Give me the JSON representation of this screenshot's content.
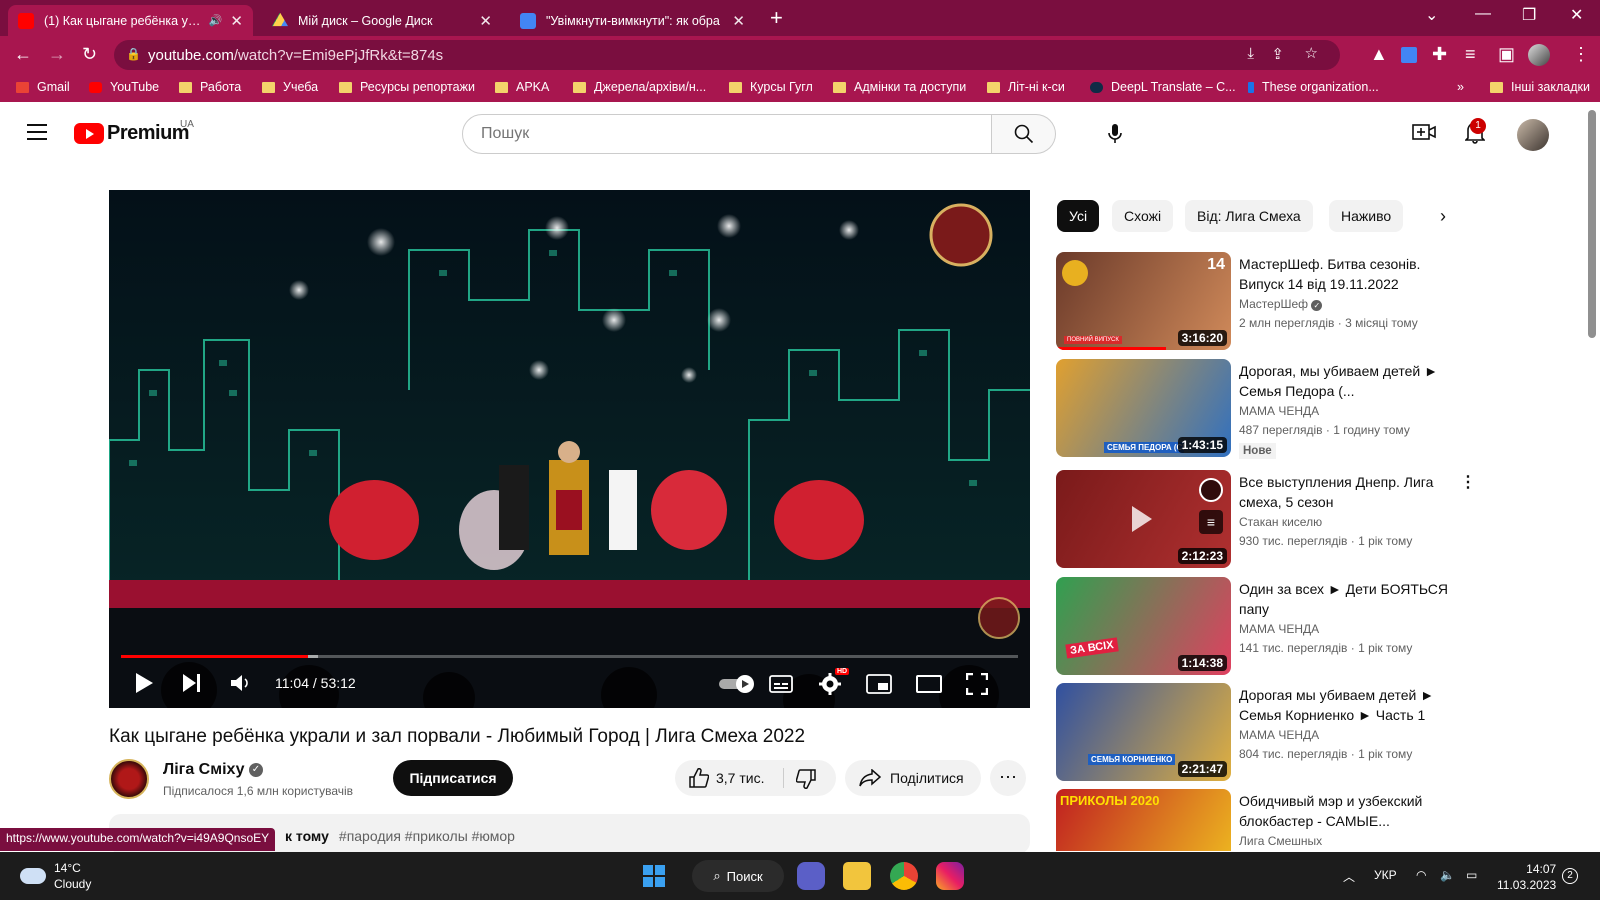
{
  "browser": {
    "tabs": [
      {
        "title": "(1) Как цыгане ребёнка укра",
        "favicon_color": "#ff0000",
        "active": true
      },
      {
        "title": "Мій диск – Google Диск",
        "favicon_color": "#1fa463",
        "active": false
      },
      {
        "title": "\"Увімкнути-вимкнути\": як обра",
        "favicon_color": "#4285f4",
        "active": false
      }
    ],
    "url_host": "youtube.com",
    "url_path": "/watch?v=Emi9ePjJfRk&t=874s",
    "bookmarks": [
      {
        "label": "Gmail",
        "type": "gmail"
      },
      {
        "label": "YouTube",
        "type": "youtube"
      },
      {
        "label": "Работа",
        "type": "folder"
      },
      {
        "label": "Учеба",
        "type": "folder"
      },
      {
        "label": "Ресурсы репортажи",
        "type": "folder"
      },
      {
        "label": "APKA",
        "type": "folder"
      },
      {
        "label": "Джерела/архіви/н...",
        "type": "folder"
      },
      {
        "label": "Курсы Гугл",
        "type": "folder"
      },
      {
        "label": "Адмінки та доступи",
        "type": "folder"
      },
      {
        "label": "Літ-ні к-си",
        "type": "folder"
      },
      {
        "label": "DeepL Translate – С...",
        "type": "deepl"
      },
      {
        "label": "These organization...",
        "type": "j"
      }
    ],
    "bookmarks_more": "»",
    "other_bookmarks": "Інші закладки",
    "status_url": "https://www.youtube.com/watch?v=i49A9QnsoEY"
  },
  "youtube": {
    "logo_text": "Premium",
    "country": "UA",
    "search_placeholder": "Пошук",
    "notification_count": "1"
  },
  "player": {
    "time_current": "11:04",
    "time_total": "53:12",
    "progress_fraction": 0.208,
    "buffer_fraction": 0.22,
    "hd_badge": "HD"
  },
  "video": {
    "title": "Как цыгане ребёнка украли и зал порвали - Любимый Город | Лига Смеха 2022",
    "channel": "Ліга Сміху",
    "subscribers": "Підписалося 1,6 млн користувачів",
    "subscribe_label": "Підписатися",
    "likes": "3,7 тис.",
    "share_label": "Поділитися",
    "more_label": "⋯",
    "desc_ago": "к тому",
    "desc_tags": "#пародия #приколы #юмор"
  },
  "chips": [
    "Усі",
    "Схожі",
    "Від: Лига Смеха",
    "Наживо"
  ],
  "recommendations": [
    {
      "title": "МастерШеф. Битва сезонів. Випуск 14 від 19.11.2022",
      "channel": "МастерШеф",
      "verified": true,
      "views": "2 млн переглядів",
      "ago": "3 місяці тому",
      "duration": "3:16:20",
      "badge": "",
      "thumb": [
        "#6b3a2a",
        "#d08a5a"
      ]
    },
    {
      "title": "Дорогая, мы убиваем детей ► Семья Педора (...",
      "channel": "МАМА ЧЕНДА",
      "verified": false,
      "views": "487 переглядів",
      "ago": "1 годину тому",
      "duration": "1:43:15",
      "badge": "Нове",
      "thumb": [
        "#e0a030",
        "#3070c0"
      ]
    },
    {
      "title": "Все выступления Днепр. Лига смеха, 5 сезон",
      "channel": "Стакан киселю",
      "verified": false,
      "views": "930 тис. переглядів",
      "ago": "1 рік тому",
      "duration": "2:12:23",
      "badge": "",
      "thumb": [
        "#7a1a1a",
        "#b03030"
      ]
    },
    {
      "title": "Один за всех ► Дети БОЯТЬСЯ папу",
      "channel": "МАМА ЧЕНДА",
      "verified": false,
      "views": "141 тис. переглядів",
      "ago": "1 рік тому",
      "duration": "1:14:38",
      "badge": "",
      "thumb": [
        "#30a050",
        "#e04060"
      ]
    },
    {
      "title": "Дорогая мы убиваем детей ► Семья Корниенко ► Часть 1",
      "channel": "МАМА ЧЕНДА",
      "verified": false,
      "views": "804 тис. переглядів",
      "ago": "1 рік тому",
      "duration": "2:21:47",
      "badge": "",
      "thumb": [
        "#3050a0",
        "#e0b040"
      ]
    },
    {
      "title": "Обидчивый мэр и узбекский блокбастер - САМЫЕ...",
      "channel": "Лига Смешных",
      "verified": false,
      "views": "",
      "ago": "",
      "duration": "",
      "badge": "",
      "thumb": [
        "#c02020",
        "#f0c020"
      ]
    }
  ],
  "recommendation_overlay_texts": {
    "rec0_number": "14",
    "rec0_band": "ПОВНИЙ ВИПУСК",
    "rec1_band": "СЕМЬЯ ПЕДОРА (СЕМЕНЧЕНК",
    "rec3_band": "ЗА ВСІХ",
    "rec4_band": "СЕМЬЯ КОРНИЕНКО",
    "rec5_band": "ПРИКОЛЫ 2020"
  },
  "taskbar": {
    "temperature": "14°C",
    "weather": "Cloudy",
    "search_label": "Поиск",
    "language": "УКР",
    "time": "14:07",
    "date": "11.03.2023",
    "notification_count": "2"
  }
}
